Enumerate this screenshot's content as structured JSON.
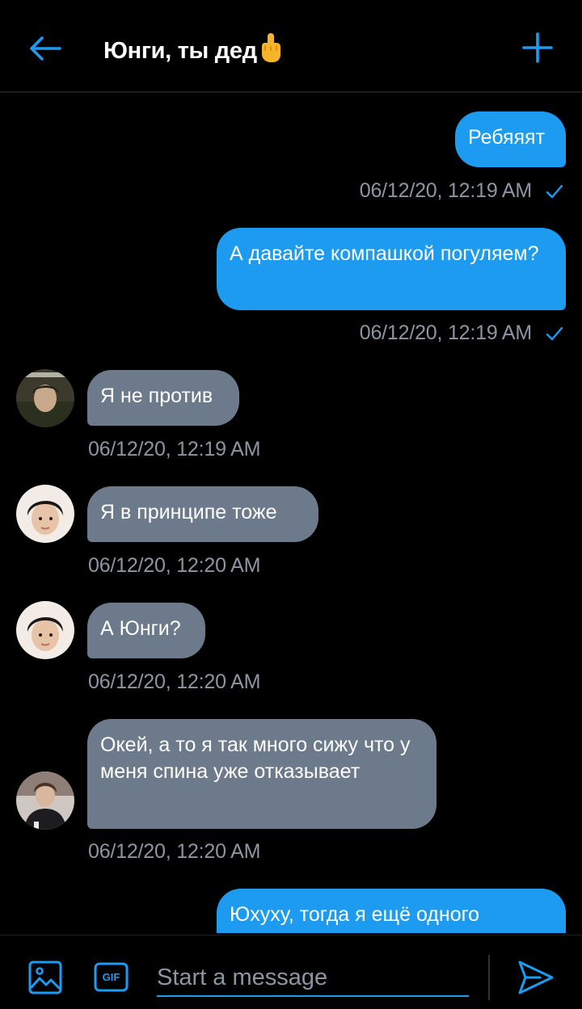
{
  "header": {
    "title": "Юнги, ты дед",
    "title_emoji": "🖕",
    "back_icon": "arrow-left-icon",
    "add_icon": "plus-icon",
    "accent": "#1d9bf0"
  },
  "messages": [
    {
      "from": "me",
      "text": "Ребяяят",
      "time": "06/12/20, 12:19 AM",
      "status_icon": "check-icon"
    },
    {
      "from": "me",
      "text": "А давайте компашкой погуляем?",
      "time": "06/12/20, 12:19 AM",
      "status_icon": "check-icon"
    },
    {
      "from": "other",
      "text": "Я не против",
      "time": "06/12/20, 12:19 AM"
    },
    {
      "from": "other",
      "text": "Я в принципе тоже",
      "time": "06/12/20, 12:20 AM"
    },
    {
      "from": "other",
      "text": "А Юнги?",
      "time": "06/12/20, 12:20 AM"
    },
    {
      "from": "other",
      "text": "Окей, а то я так много сижу что у меня спина уже отказывает",
      "time": "06/12/20, 12:20 AM"
    },
    {
      "from": "me",
      "text": "Юхуху, тогда я ещё одного"
    }
  ],
  "composer": {
    "placeholder": "Start a message",
    "media_icon": "image-icon",
    "gif_label": "GIF",
    "send_icon": "send-icon"
  },
  "colors": {
    "background": "#000000",
    "outgoing_bubble": "#1d9bf0",
    "incoming_bubble": "#6d7a8c",
    "timestamp": "#8b96a3"
  }
}
